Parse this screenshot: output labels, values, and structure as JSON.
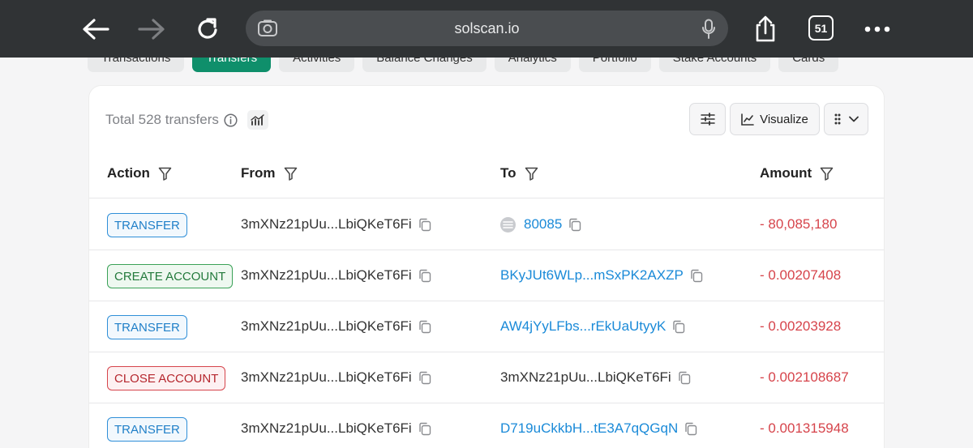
{
  "browser": {
    "url": "solscan.io",
    "tab_count": "51"
  },
  "page_tabs": [
    {
      "label": "Transactions",
      "active": false
    },
    {
      "label": "Transfers",
      "active": true
    },
    {
      "label": "Activities",
      "active": false
    },
    {
      "label": "Balance Changes",
      "active": false
    },
    {
      "label": "Analytics",
      "active": false
    },
    {
      "label": "Portfolio",
      "active": false
    },
    {
      "label": "Stake Accounts",
      "active": false
    },
    {
      "label": "Cards",
      "active": false
    }
  ],
  "toolbar": {
    "total_label": "Total 528 transfers",
    "visualize_label": "Visualize"
  },
  "columns": {
    "action": "Action",
    "from": "From",
    "to": "To",
    "amount": "Amount"
  },
  "rows": [
    {
      "action": "TRANSFER",
      "type": "transfer",
      "from": "3mXNz21pUu...LbiQKeT6Fi",
      "to": "80085",
      "to_link": true,
      "to_token_icon": true,
      "amount": "- 80,085,180"
    },
    {
      "action": "CREATE ACCOUNT",
      "type": "create",
      "from": "3mXNz21pUu...LbiQKeT6Fi",
      "to": "BKyJUt6WLp...mSxPK2AXZP",
      "to_link": true,
      "to_token_icon": false,
      "amount": "- 0.00207408"
    },
    {
      "action": "TRANSFER",
      "type": "transfer",
      "from": "3mXNz21pUu...LbiQKeT6Fi",
      "to": "AW4jYyLFbs...rEkUaUtyyK",
      "to_link": true,
      "to_token_icon": false,
      "amount": "- 0.00203928"
    },
    {
      "action": "CLOSE ACCOUNT",
      "type": "close",
      "from": "3mXNz21pUu...LbiQKeT6Fi",
      "to": "3mXNz21pUu...LbiQKeT6Fi",
      "to_link": false,
      "to_token_icon": false,
      "amount": "- 0.002108687"
    },
    {
      "action": "TRANSFER",
      "type": "transfer",
      "from": "3mXNz21pUu...LbiQKeT6Fi",
      "to": "D719uCkkbH...tE3A7qQGqN",
      "to_link": true,
      "to_token_icon": false,
      "amount": "- 0.001315948"
    }
  ],
  "colors": {
    "browser_bar": "#303335",
    "active_tab": "#0f8f6b",
    "link": "#1a8ad8",
    "amount_negative": "#d6444b"
  },
  "icons": [
    "back-arrow-icon",
    "forward-arrow-icon",
    "reload-icon",
    "lens-icon",
    "mic-icon",
    "share-icon",
    "more-icon",
    "info-icon",
    "chart-icon",
    "filter-settings-icon",
    "visualize-chart-icon",
    "grid-dots-icon",
    "chevron-down-icon",
    "funnel-icon",
    "copy-icon",
    "token-icon"
  ]
}
